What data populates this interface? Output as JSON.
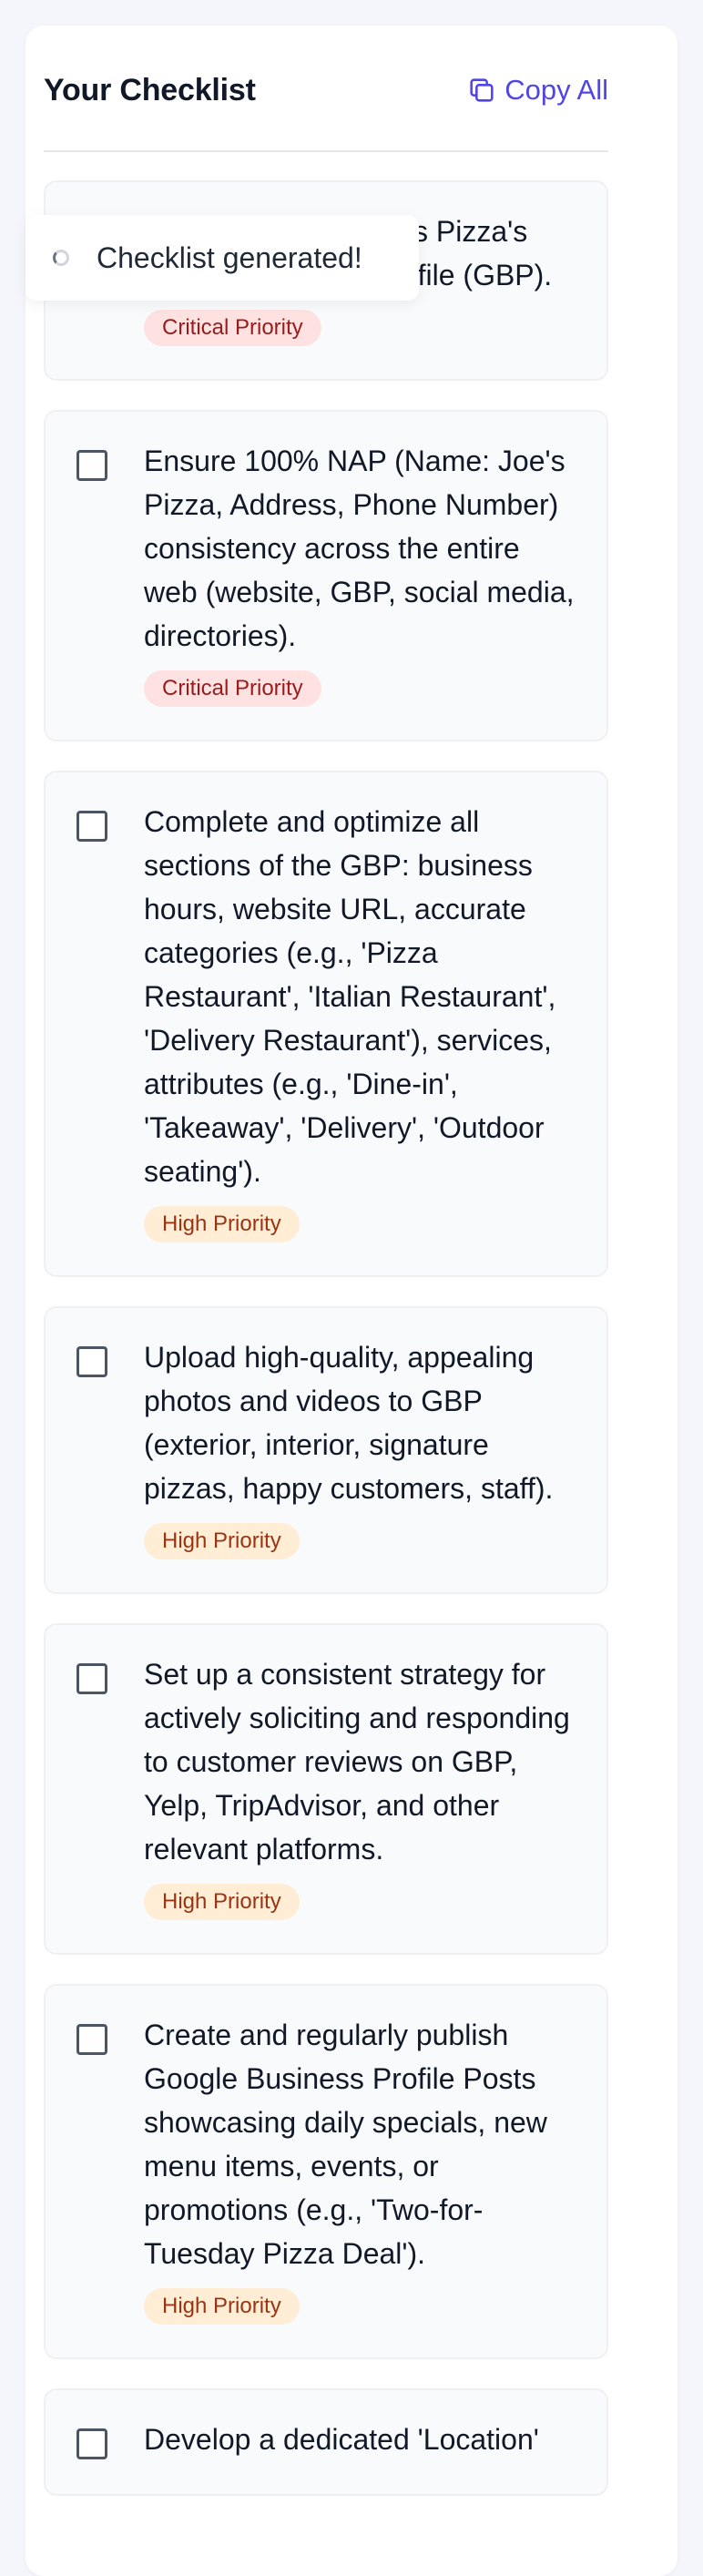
{
  "header": {
    "title": "Your Checklist",
    "copy_all_label": "Copy All"
  },
  "toast": {
    "message": "Checklist generated!"
  },
  "items": [
    {
      "text": "Claim and verify Joe's Pizza's Google Business Profile (GBP).",
      "priority": "Critical Priority",
      "level": "critical"
    },
    {
      "text": "Ensure 100% NAP (Name: Joe's Pizza, Address, Phone Number) consistency across the entire web (website, GBP, social media, directories).",
      "priority": "Critical Priority",
      "level": "critical"
    },
    {
      "text": "Complete and optimize all sections of the GBP: business hours, website URL, accurate categories (e.g., 'Pizza Restaurant', 'Italian Restaurant', 'Delivery Restaurant'), services, attributes (e.g., 'Dine-in', 'Takeaway', 'Delivery', 'Outdoor seating').",
      "priority": "High Priority",
      "level": "high"
    },
    {
      "text": "Upload high-quality, appealing photos and videos to GBP (exterior, interior, signature pizzas, happy customers, staff).",
      "priority": "High Priority",
      "level": "high"
    },
    {
      "text": "Set up a consistent strategy for actively soliciting and responding to customer reviews on GBP, Yelp, TripAdvisor, and other relevant platforms.",
      "priority": "High Priority",
      "level": "high"
    },
    {
      "text": "Create and regularly publish Google Business Profile Posts showcasing daily specials, new menu items, events, or promotions (e.g., 'Two-for-Tuesday Pizza Deal').",
      "priority": "High Priority",
      "level": "high"
    },
    {
      "text": "Develop a dedicated 'Location'",
      "priority": "",
      "level": "high"
    }
  ],
  "colors": {
    "accent": "#4f46e5",
    "critical_bg": "#fee2e2",
    "critical_text": "#991b1b",
    "high_bg": "#ffedd5",
    "high_text": "#9a3412"
  }
}
